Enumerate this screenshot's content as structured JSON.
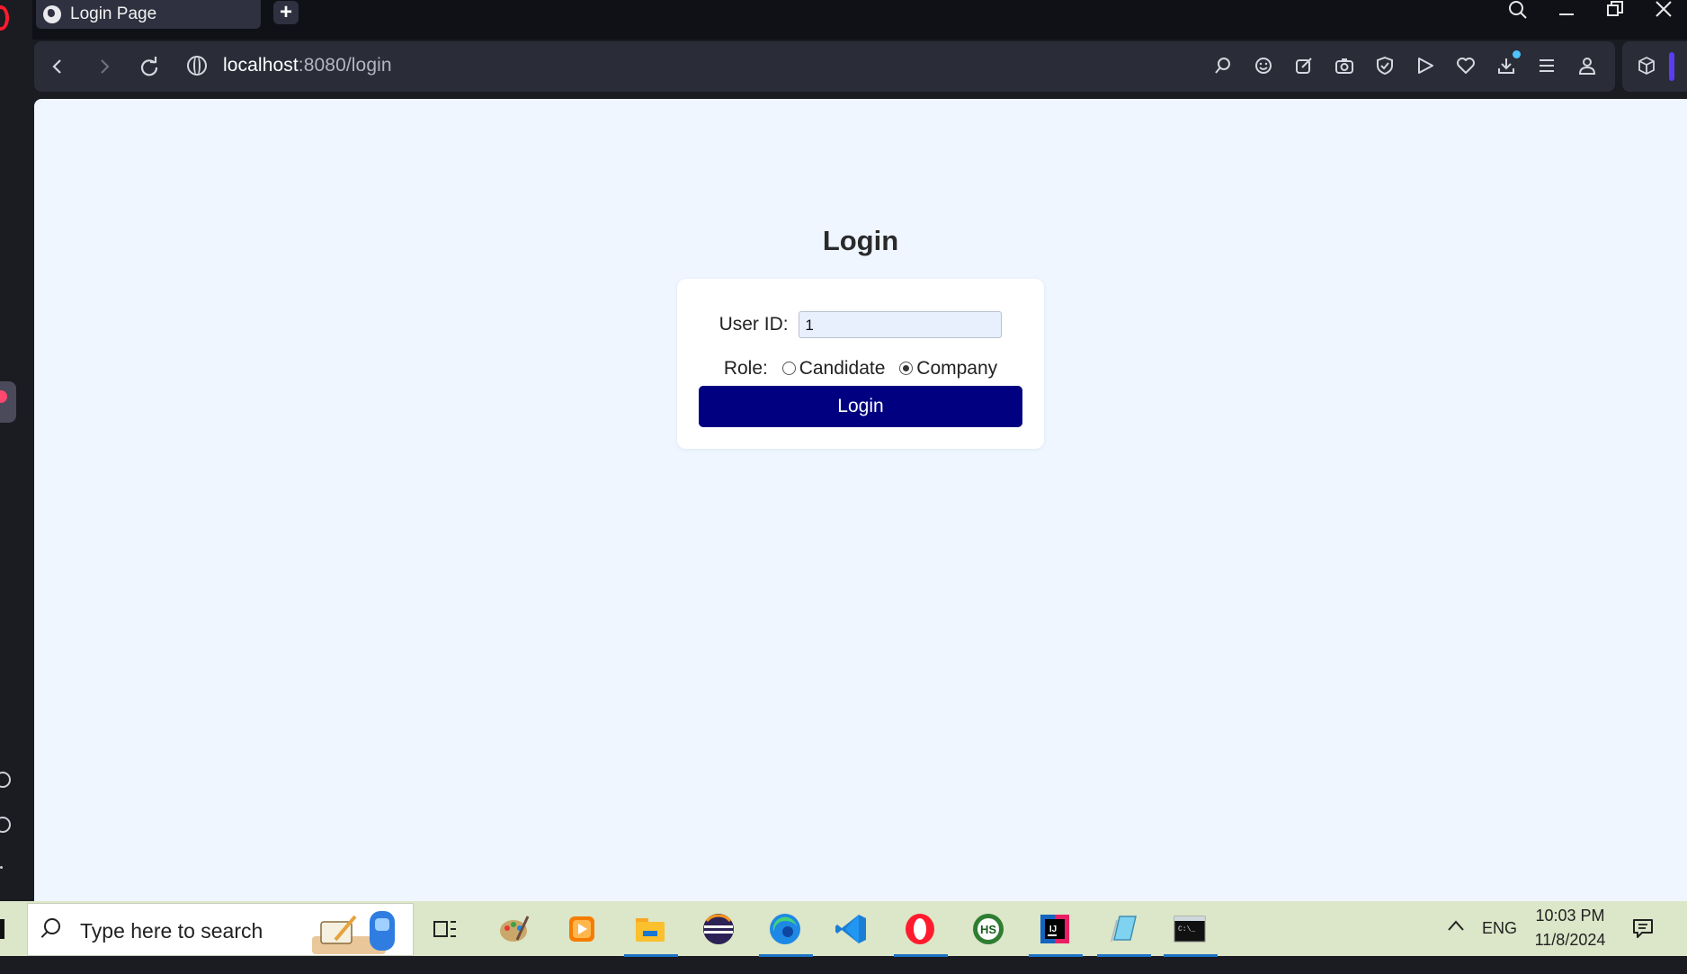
{
  "browser": {
    "tab_title": "Login Page",
    "new_tab_label": "+",
    "url_host": "localhost",
    "url_rest": ":8080/login"
  },
  "page": {
    "title": "Login",
    "user_id_label": "User ID:",
    "user_id_value": "1",
    "role_label": "Role:",
    "role_options": [
      "Candidate",
      "Company"
    ],
    "role_selected": "Company",
    "login_button": "Login"
  },
  "taskbar": {
    "search_placeholder": "Type here to search",
    "language": "ENG",
    "time": "10:03 PM",
    "date": "11/8/2024"
  },
  "icons": {
    "toolbar": [
      "back-icon",
      "forward-icon",
      "reload-icon",
      "site-info-icon",
      "search-page-icon",
      "emoji-icon",
      "share-icon",
      "snapshot-icon",
      "shield-icon",
      "send-icon",
      "heart-icon",
      "download-icon",
      "menu-icon",
      "profile-icon",
      "extensions-icon"
    ],
    "taskbar_apps": [
      "task-view-icon",
      "paint-icon",
      "media-player-icon",
      "file-explorer-icon",
      "eclipse-icon",
      "edge-icon",
      "vscode-icon",
      "opera-icon",
      "hs-icon",
      "intellij-icon",
      "notepad-icon",
      "terminal-icon"
    ]
  },
  "colors": {
    "page_bg": "#eff6ff",
    "login_button": "#000080",
    "browser_chrome": "#2a2c38",
    "taskbar": "#dce6c8"
  }
}
